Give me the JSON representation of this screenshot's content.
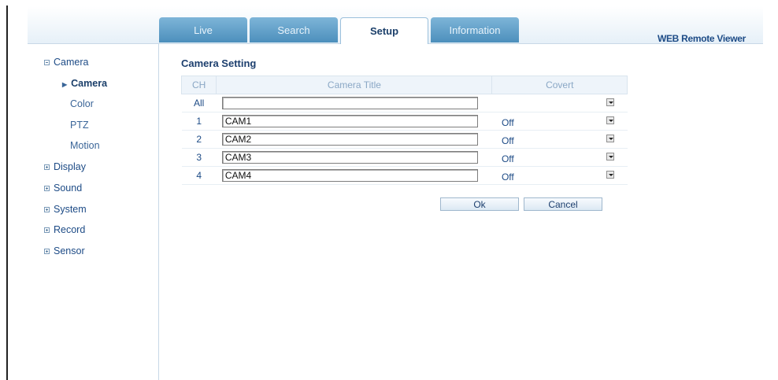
{
  "header": {
    "tabs": [
      {
        "label": "Live",
        "active": false
      },
      {
        "label": "Search",
        "active": false
      },
      {
        "label": "Setup",
        "active": true
      },
      {
        "label": "Information",
        "active": false
      }
    ],
    "brand": "WEB Remote Viewer"
  },
  "sidebar": {
    "groups": [
      {
        "label": "Camera",
        "expanded": true
      },
      {
        "label": "Display",
        "expanded": false
      },
      {
        "label": "Sound",
        "expanded": false
      },
      {
        "label": "System",
        "expanded": false
      },
      {
        "label": "Record",
        "expanded": false
      },
      {
        "label": "Sensor",
        "expanded": false
      }
    ],
    "camera_sub": [
      {
        "label": "Camera",
        "active": true
      },
      {
        "label": "Color",
        "active": false
      },
      {
        "label": "PTZ",
        "active": false
      },
      {
        "label": "Motion",
        "active": false
      }
    ]
  },
  "main": {
    "title": "Camera Setting",
    "columns": [
      "CH",
      "Camera Title",
      "Covert"
    ],
    "rows": [
      {
        "ch": "All",
        "title": "",
        "covert": ""
      },
      {
        "ch": "1",
        "title": "CAM1",
        "covert": "Off"
      },
      {
        "ch": "2",
        "title": "CAM2",
        "covert": "Off"
      },
      {
        "ch": "3",
        "title": "CAM3",
        "covert": "Off"
      },
      {
        "ch": "4",
        "title": "CAM4",
        "covert": "Off"
      }
    ],
    "ok_label": "Ok",
    "cancel_label": "Cancel"
  },
  "colors": {
    "tab_bg": "#5e9dc8",
    "accent_text": "#1d4b86",
    "header_border": "#c8d8e6"
  }
}
